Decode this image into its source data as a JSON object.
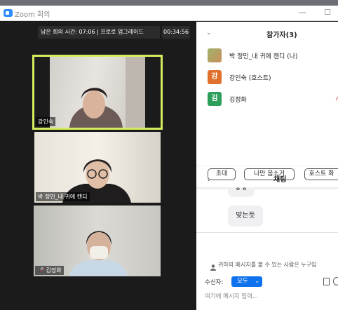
{
  "window": {
    "title": "Zoom 회의",
    "minimize": "—",
    "maximize": "☐"
  },
  "meeting": {
    "time_notice": "남은 회의 시간: 07:06 | 프로로 업그레이드",
    "elapsed": "00:34:56"
  },
  "videos": [
    {
      "name": "강인숙",
      "active_speaker": true
    },
    {
      "name": "박 정민_내 귀에 캔디"
    },
    {
      "name": "김정화",
      "muted": true
    }
  ],
  "participants_panel": {
    "title": "참가자(3)",
    "participants": [
      {
        "name": "박 정민_내 귀에 캔디 (나)",
        "avatar_type": "photo"
      },
      {
        "name": "강인숙 (호스트)",
        "initial": "강",
        "color": "#e0702c"
      },
      {
        "name": "김정화",
        "initial": "김",
        "color": "#2e9e5b"
      }
    ],
    "buttons": {
      "invite": "초대",
      "mute_me": "나만 음소거",
      "host_tools": "호스트 화"
    }
  },
  "chat_panel": {
    "title": "채팅",
    "messages": [
      "ㅎㅎ",
      "맞는듯"
    ],
    "visibility_notice": "귀하의 메시지를 볼 수 있는 사람은 누구입",
    "recipient_label": "수신자:",
    "recipient_value": "모두",
    "input_placeholder": "여기에 메시지 입력..."
  },
  "colors": {
    "accent": "#0e72ed",
    "speaker_border": "#d5ec5f",
    "dark_bg": "#1b1b1b"
  }
}
